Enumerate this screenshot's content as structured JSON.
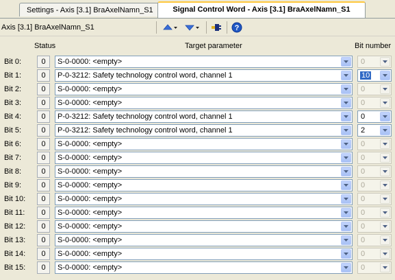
{
  "tabs": [
    {
      "label": "Settings - Axis [3.1] BraAxelNamn_S1",
      "active": false
    },
    {
      "label": "Signal Control Word - Axis [3.1] BraAxelNamn_S1",
      "active": true
    }
  ],
  "toolbar": {
    "title": "Axis [3.1] BraAxelNamn_S1",
    "icons": [
      "move-up-icon",
      "move-down-icon",
      "connect-icon",
      "help-icon"
    ]
  },
  "headers": {
    "status": "Status",
    "target": "Target parameter",
    "bit_number": "Bit number"
  },
  "colors": {
    "accent": "#ffc83c",
    "selection": "#316ac5",
    "help": "#1f57c3"
  },
  "rows": [
    {
      "label": "Bit 0:",
      "status": "0",
      "param": "S-0-0000: <empty>",
      "bit": "0",
      "enabled": false
    },
    {
      "label": "Bit 1:",
      "status": "0",
      "param": "P-0-3212: Safety technology control word, channel 1",
      "bit": "10",
      "enabled": true,
      "selected": true
    },
    {
      "label": "Bit 2:",
      "status": "0",
      "param": "S-0-0000: <empty>",
      "bit": "0",
      "enabled": false
    },
    {
      "label": "Bit 3:",
      "status": "0",
      "param": "S-0-0000: <empty>",
      "bit": "0",
      "enabled": false
    },
    {
      "label": "Bit 4:",
      "status": "0",
      "param": "P-0-3212: Safety technology control word, channel 1",
      "bit": "0",
      "enabled": true
    },
    {
      "label": "Bit 5:",
      "status": "0",
      "param": "P-0-3212: Safety technology control word, channel 1",
      "bit": "2",
      "enabled": true
    },
    {
      "label": "Bit 6:",
      "status": "0",
      "param": "S-0-0000: <empty>",
      "bit": "0",
      "enabled": false
    },
    {
      "label": "Bit 7:",
      "status": "0",
      "param": "S-0-0000: <empty>",
      "bit": "0",
      "enabled": false
    },
    {
      "label": "Bit 8:",
      "status": "0",
      "param": "S-0-0000: <empty>",
      "bit": "0",
      "enabled": false
    },
    {
      "label": "Bit 9:",
      "status": "0",
      "param": "S-0-0000: <empty>",
      "bit": "0",
      "enabled": false
    },
    {
      "label": "Bit 10:",
      "status": "0",
      "param": "S-0-0000: <empty>",
      "bit": "0",
      "enabled": false
    },
    {
      "label": "Bit 11:",
      "status": "0",
      "param": "S-0-0000: <empty>",
      "bit": "0",
      "enabled": false
    },
    {
      "label": "Bit 12:",
      "status": "0",
      "param": "S-0-0000: <empty>",
      "bit": "0",
      "enabled": false
    },
    {
      "label": "Bit 13:",
      "status": "0",
      "param": "S-0-0000: <empty>",
      "bit": "0",
      "enabled": false
    },
    {
      "label": "Bit 14:",
      "status": "0",
      "param": "S-0-0000: <empty>",
      "bit": "0",
      "enabled": false
    },
    {
      "label": "Bit 15:",
      "status": "0",
      "param": "S-0-0000: <empty>",
      "bit": "0",
      "enabled": false
    }
  ]
}
